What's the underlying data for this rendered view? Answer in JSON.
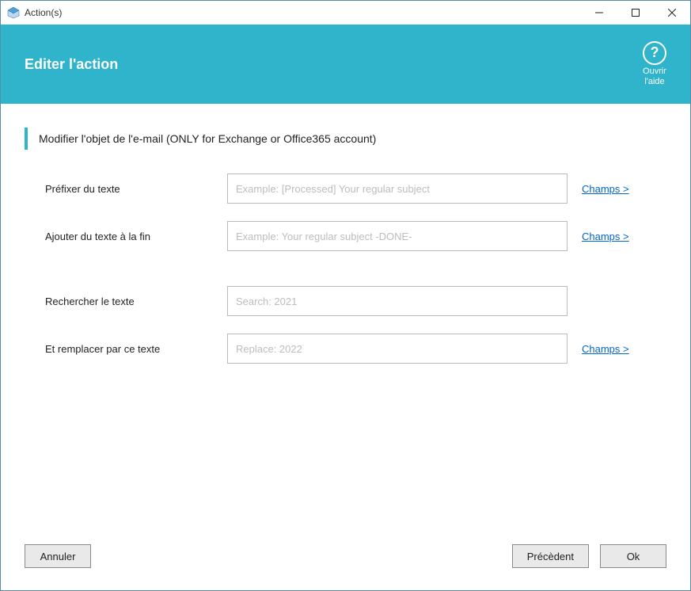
{
  "window": {
    "title": "Action(s)"
  },
  "banner": {
    "heading": "Editer l'action",
    "help_label_1": "Ouvrir",
    "help_label_2": "l'aide"
  },
  "section": {
    "heading": "Modifier l'objet de l'e-mail (ONLY for Exchange or Office365 account)"
  },
  "fields": {
    "prefix": {
      "label": "Préfixer du texte",
      "placeholder": "Example: [Processed] Your regular subject",
      "value": "",
      "champs": "Champs >"
    },
    "append": {
      "label": "Ajouter du texte à la fin",
      "placeholder": "Example: Your regular subject -DONE-",
      "value": "",
      "champs": "Champs >"
    },
    "search": {
      "label": "Rechercher le texte",
      "placeholder": "Search: 2021",
      "value": ""
    },
    "replace": {
      "label": "Et remplacer par ce texte",
      "placeholder": "Replace: 2022",
      "value": "",
      "champs": "Champs >"
    }
  },
  "footer": {
    "cancel": "Annuler",
    "previous": "Précèdent",
    "ok": "Ok"
  }
}
